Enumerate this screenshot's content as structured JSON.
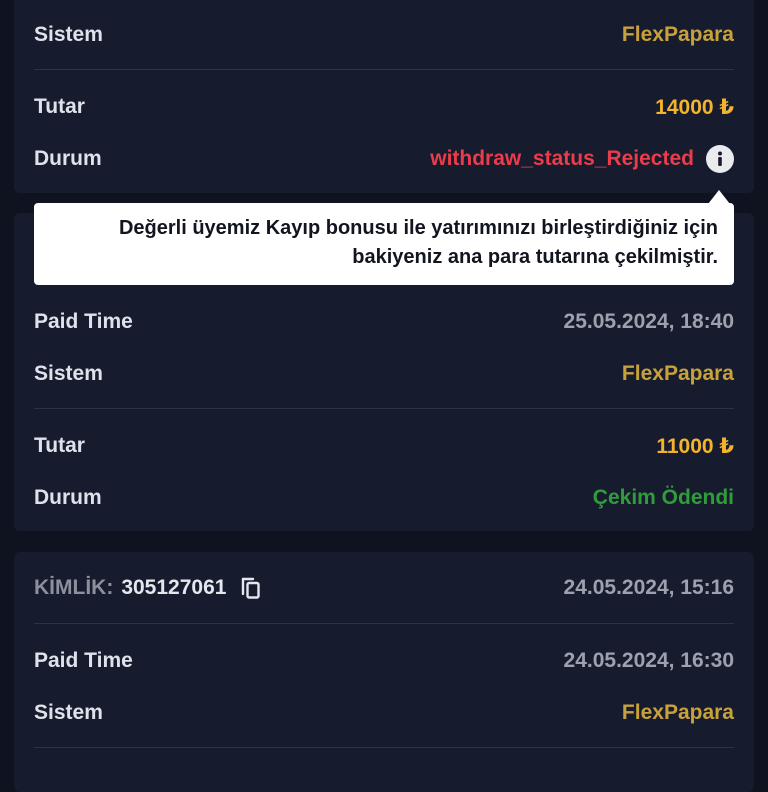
{
  "colors": {
    "background": "#0f1320",
    "card": "#161c2e",
    "system": "#c8a13a",
    "amount": "#f3b32c",
    "rejected": "#ec3b4a",
    "paid": "#2f9d39"
  },
  "card1": {
    "system_label": "Sistem",
    "system_value": "FlexPapara",
    "amount_label": "Tutar",
    "amount_value": "14000 ₺",
    "status_label": "Durum",
    "status_value": "withdraw_status_Rejected",
    "info_icon": "info-icon"
  },
  "tooltip": {
    "line1": "Değerli üyemiz Kayıp bonusu ile yatırımınızı birleştirdiğiniz için",
    "line2": "bakiyeniz ana para tutarına çekilmiştir."
  },
  "card2": {
    "paid_time_label": "Paid Time",
    "paid_time_value": "25.05.2024, 18:40",
    "system_label": "Sistem",
    "system_value": "FlexPapara",
    "amount_label": "Tutar",
    "amount_value": "11000 ₺",
    "status_label": "Durum",
    "status_value": "Çekim Ödendi"
  },
  "card3": {
    "id_label": "KİMLİK:",
    "id_value": "305127061",
    "copy_icon": "copy-icon",
    "created_time": "24.05.2024, 15:16",
    "paid_time_label": "Paid Time",
    "paid_time_value": "24.05.2024, 16:30",
    "system_label": "Sistem",
    "system_value": "FlexPapara"
  }
}
